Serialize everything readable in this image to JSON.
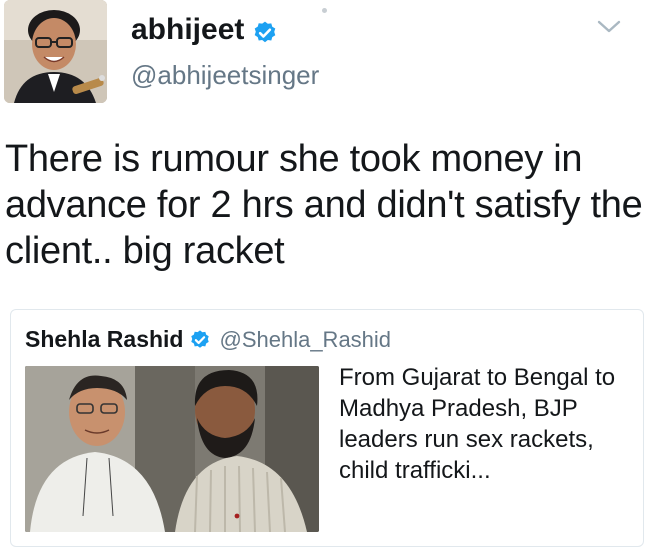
{
  "tweet": {
    "author_name": "abhijeet",
    "author_handle": "@abhijeetsinger",
    "text": "There is rumour she took money in advance for 2 hrs and didn't satisfy the client.. big racket",
    "verified": true
  },
  "quoted_tweet": {
    "author_name": "Shehla Rashid",
    "author_handle": "@Shehla_Rashid",
    "text": "From Gujarat to Bengal to Madhya Pradesh, BJP leaders run sex rackets, child trafficki...",
    "verified": true
  },
  "icons": {
    "verified": "verified-badge-icon",
    "menu": "chevron-down-icon"
  },
  "colors": {
    "verified_blue": "#1da1f2",
    "text_primary": "#14171a",
    "text_secondary": "#657786",
    "card_border": "#e1e8ed"
  }
}
